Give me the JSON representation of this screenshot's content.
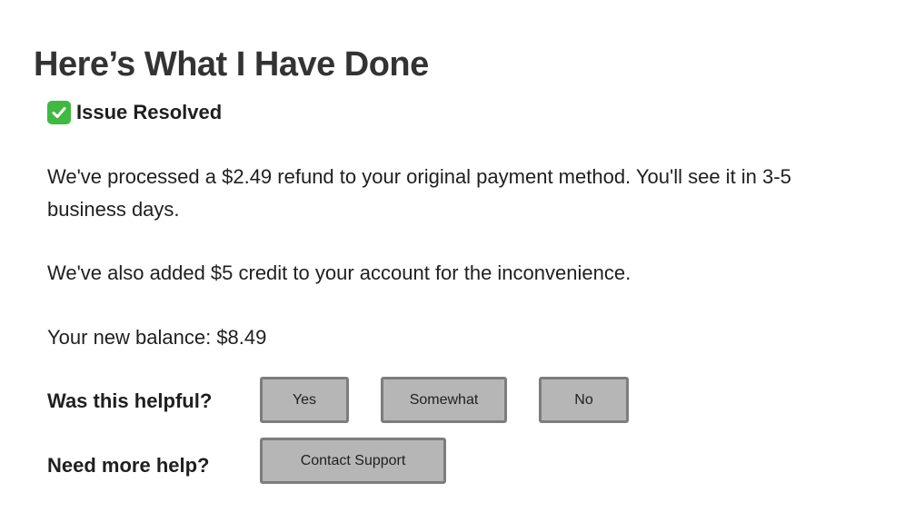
{
  "header": {
    "title": "Here’s What I Have Done"
  },
  "status": {
    "icon": "check-mark-icon",
    "icon_color": "#3fb93f",
    "label": "Issue Resolved"
  },
  "message": {
    "refund_text": "We've processed a $2.49 refund to your original payment method. You'll see it in 3-5 business days.",
    "credit_text": "We've also added $5 credit to your account for the inconvenience.",
    "balance_text": "Your new balance: $8.49"
  },
  "feedback": {
    "question": "Was this helpful?",
    "options": [
      "Yes",
      "Somewhat",
      "No"
    ]
  },
  "help": {
    "question": "Need more help?",
    "button_label": "Contact Support"
  }
}
